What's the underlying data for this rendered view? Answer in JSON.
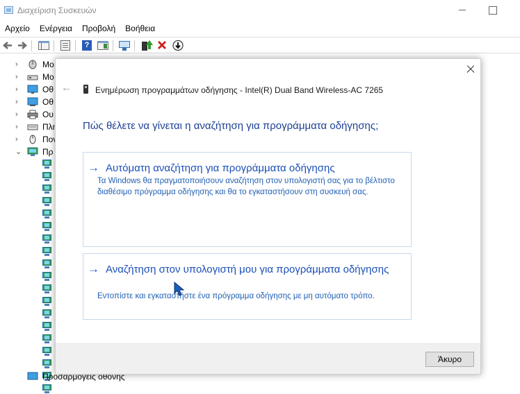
{
  "window": {
    "title": "Διαχείριση Συσκευών"
  },
  "menu": {
    "items": [
      "Αρχείο",
      "Ενέργεια",
      "Προβολή",
      "Βοήθεια"
    ]
  },
  "toolbar": {
    "buttons": [
      "back-icon",
      "forward-icon",
      "show-hide-console-tree-icon",
      "properties-icon",
      "help-icon",
      "action-pane-icon",
      "scan-hardware-icon",
      "update-driver-icon",
      "uninstall-icon",
      "download-icon"
    ]
  },
  "tree": {
    "categories": [
      {
        "label": "Μο",
        "icon": "mouse-icon",
        "expanded": false
      },
      {
        "label": "Μο",
        "icon": "modem-icon",
        "expanded": false
      },
      {
        "label": "Οθ",
        "icon": "monitor-icon",
        "expanded": false
      },
      {
        "label": "Οθ",
        "icon": "display-adapter-icon",
        "expanded": false
      },
      {
        "label": "Ου",
        "icon": "print-queue-icon",
        "expanded": false
      },
      {
        "label": "Πλη",
        "icon": "keyboard-icon",
        "expanded": false
      },
      {
        "label": "Πον",
        "icon": "pointing-device-icon",
        "expanded": false
      },
      {
        "label": "Πρ",
        "icon": "network-adapter-icon",
        "expanded": true
      }
    ],
    "network_child_count": 19,
    "bottom_label": "Προσαρμογείς οθόνης"
  },
  "dialog": {
    "title": "Ενημέρωση προγραμμάτων οδήγησης - Intel(R) Dual Band Wireless-AC 7265",
    "question": "Πώς θέλετε να γίνεται η αναζήτηση για προγράμματα οδήγησης;",
    "options": [
      {
        "title": "Αυτόματη αναζήτηση για προγράμματα οδήγησης",
        "description": "Τα Windows θα πραγματοποιήσουν αναζήτηση στον υπολογιστή σας για το βέλτιστο διαθέσιμο πρόγραμμα οδήγησης και θα το εγκαταστήσουν στη συσκευή σας."
      },
      {
        "title": "Αναζήτηση στον υπολογιστή μου για προγράμματα οδήγησης",
        "description": "Εντοπίστε και εγκαταστήστε ένα πρόγραμμα οδήγησης με μη αυτόματο τρόπο."
      }
    ],
    "cancel_label": "Άκυρο"
  },
  "colors": {
    "accent": "#1a4fb8",
    "question": "#1c3f94",
    "description": "#1f5fb3"
  }
}
